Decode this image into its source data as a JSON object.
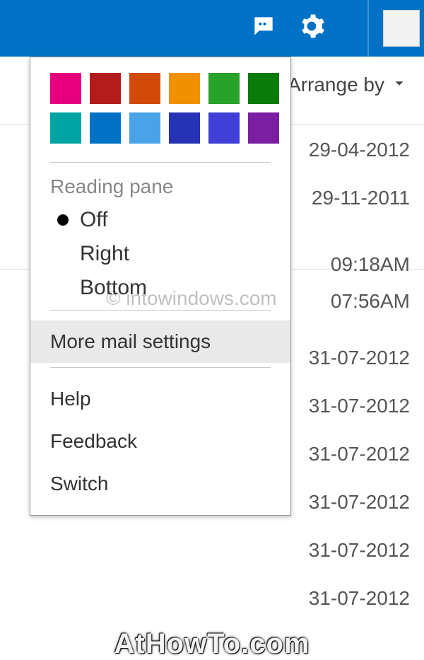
{
  "header": {
    "accent_color": "#0072c6"
  },
  "arrange_by": {
    "label": "Arrange by"
  },
  "mail_list": {
    "rows": [
      "29-04-2012",
      "29-11-2011",
      "09:18AM",
      "07:56AM",
      "31-07-2012",
      "31-07-2012",
      "31-07-2012",
      "31-07-2012",
      "31-07-2012",
      "31-07-2012"
    ]
  },
  "dropdown": {
    "color_swatches": [
      "#e6007e",
      "#b21c1c",
      "#d14a0a",
      "#f29100",
      "#28a228",
      "#0a7a0a",
      "#00a3a3",
      "#0072c6",
      "#4aa3e6",
      "#2733b5",
      "#4040d8",
      "#7a1fa2"
    ],
    "reading_pane": {
      "title": "Reading pane",
      "options": {
        "off": "Off",
        "right": "Right",
        "bottom": "Bottom"
      },
      "selected": "off"
    },
    "more_mail_settings": "More mail settings",
    "help": "Help",
    "feedback": "Feedback",
    "switch": "Switch"
  },
  "watermarks": {
    "w1": "© intowindows.com",
    "w2": "AtHowTo.com"
  }
}
